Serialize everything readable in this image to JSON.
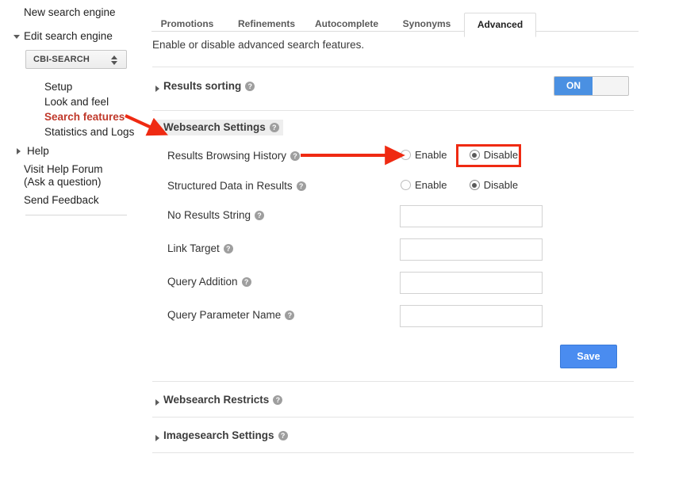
{
  "sidebar": {
    "new_search_engine": "New search engine",
    "edit_search_engine": "Edit search engine",
    "engine_selected": "CBI-SEARCH",
    "sub_items": [
      {
        "label": "Setup",
        "active": false
      },
      {
        "label": "Look and feel",
        "active": false
      },
      {
        "label": "Search features",
        "active": true
      },
      {
        "label": "Statistics and Logs",
        "active": false
      }
    ],
    "help": "Help",
    "visit_forum_line1": "Visit Help Forum",
    "visit_forum_line2": "(Ask a question)",
    "send_feedback": "Send Feedback"
  },
  "tabs": [
    {
      "label": "Promotions",
      "active": false
    },
    {
      "label": "Refinements",
      "active": false
    },
    {
      "label": "Autocomplete",
      "active": false
    },
    {
      "label": "Synonyms",
      "active": false
    },
    {
      "label": "Advanced",
      "active": true
    }
  ],
  "page": {
    "description": "Enable or disable advanced search features."
  },
  "sections": {
    "results_sorting": {
      "title": "Results sorting",
      "expanded": false,
      "toggle_label": "ON",
      "toggle_state": "on"
    },
    "websearch_settings": {
      "title": "Websearch Settings",
      "expanded": true
    },
    "websearch_restricts": {
      "title": "Websearch Restricts",
      "expanded": false
    },
    "imagesearch_settings": {
      "title": "Imagesearch Settings",
      "expanded": false
    }
  },
  "form": {
    "radio_rows": [
      {
        "label": "Results Browsing History",
        "enable_label": "Enable",
        "disable_label": "Disable",
        "selected": "Disable",
        "highlighted": true
      },
      {
        "label": "Structured Data in Results",
        "enable_label": "Enable",
        "disable_label": "Disable",
        "selected": "Disable",
        "highlighted": false
      }
    ],
    "text_rows": [
      {
        "label": "No Results String",
        "value": "",
        "placeholder": ""
      },
      {
        "label": "Link Target",
        "value": "",
        "placeholder": ""
      },
      {
        "label": "Query Addition",
        "value": "",
        "placeholder": ""
      },
      {
        "label": "Query Parameter Name",
        "value": "",
        "placeholder": ""
      }
    ],
    "save_label": "Save"
  },
  "icons": {
    "help": "?",
    "help_name": "help-question-icon"
  },
  "colors": {
    "accent_blue": "#4a8cf0",
    "toggle_blue": "#4a90e2",
    "annotation_red": "#ef2a12",
    "active_link_red": "#c0392b"
  }
}
